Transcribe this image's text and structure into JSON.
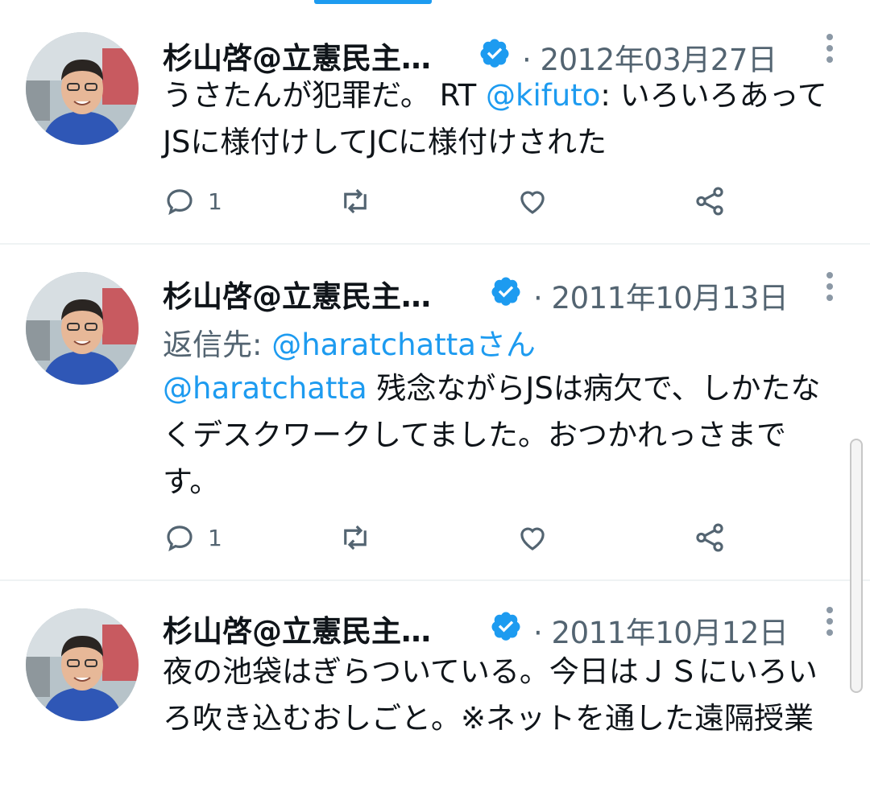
{
  "tweets": [
    {
      "author_name": "杉山啓@立憲民主…",
      "date": "2012年03月27日",
      "body_text_1": "うさたんが犯罪だ。 RT ",
      "body_mention": "@kifuto",
      "body_text_2": ": いろいろあってJSに様付けしてJCに様付けされた",
      "reply_count": "1"
    },
    {
      "author_name": "杉山啓@立憲民主…",
      "date": "2011年10月13日",
      "reply_to_label": "返信先: ",
      "reply_to_handle": "@haratchattaさん",
      "body_mention": "@haratchatta",
      "body_text_2": " 残念ながらJSは病欠で、しかたなくデスクワークしてました。おつかれっさまです。",
      "reply_count": "1"
    },
    {
      "author_name": "杉山啓@立憲民主…",
      "date": "2011年10月12日",
      "body_text_1": "夜の池袋はぎらついている。今日はＪＳにいろいろ吹き込むおしごと。※ネットを通した遠隔授業"
    }
  ],
  "icons": {
    "verified": "verified-badge-icon",
    "more": "more-options-icon",
    "reply": "reply-icon",
    "retweet": "retweet-icon",
    "like": "like-icon",
    "share": "share-icon"
  },
  "colors": {
    "accent": "#1d9bf0",
    "secondary_text": "#536471",
    "icon": "#536471",
    "divider": "#eff3f4"
  }
}
